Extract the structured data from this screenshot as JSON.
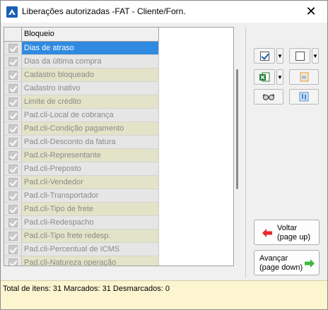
{
  "window": {
    "title": "Liberações autorizadas -FAT - Cliente/Forn.",
    "close_glyph": "✕",
    "icon": "app-icon"
  },
  "grid": {
    "column_header": "Bloqueio",
    "rows": [
      {
        "label": "Dias de atraso",
        "checked": true,
        "selected": true
      },
      {
        "label": "Dias da última compra",
        "checked": true
      },
      {
        "label": "Cadastro bloqueado",
        "checked": true
      },
      {
        "label": "Cadastro inativo",
        "checked": true
      },
      {
        "label": "Limite de crédito",
        "checked": true
      },
      {
        "label": "Pad.cli-Local de cobrança",
        "checked": true
      },
      {
        "label": "Pad.cli-Condição pagamento",
        "checked": true
      },
      {
        "label": "Pad.cli-Desconto da fatura",
        "checked": true
      },
      {
        "label": "Pad.cli-Representante",
        "checked": true
      },
      {
        "label": "Pad.cli-Preposto",
        "checked": true
      },
      {
        "label": "Pad.cli-Vendedor",
        "checked": true
      },
      {
        "label": "Pad.cli-Transportador",
        "checked": true
      },
      {
        "label": "Pad.cli-Tipo de frete",
        "checked": true
      },
      {
        "label": "Pad.cli-Redespacho",
        "checked": true
      },
      {
        "label": "Pad.cli-Tipo frete redesp.",
        "checked": true
      },
      {
        "label": "Pad.cli-Percentual de ICMS",
        "checked": true
      },
      {
        "label": "Pad.cli-Natureza operação",
        "checked": true
      }
    ]
  },
  "toolbar": {
    "icons": [
      "check-all-icon",
      "uncheck-all-icon",
      "excel-export-icon",
      "report-icon",
      "glasses-icon",
      "filter-icon"
    ],
    "drop_glyph": "▼"
  },
  "nav": {
    "back_line1": "Voltar",
    "back_line2": "(page up)",
    "next_line1": "Avançar",
    "next_line2": "(page down)"
  },
  "status": {
    "text": "Total de itens: 31 Marcados: 31 Desmarcados: 0"
  },
  "colors": {
    "selected_row": "#2f8ae0",
    "alt_row": "#e3e3c8",
    "status_bg": "#fcf5d0"
  }
}
